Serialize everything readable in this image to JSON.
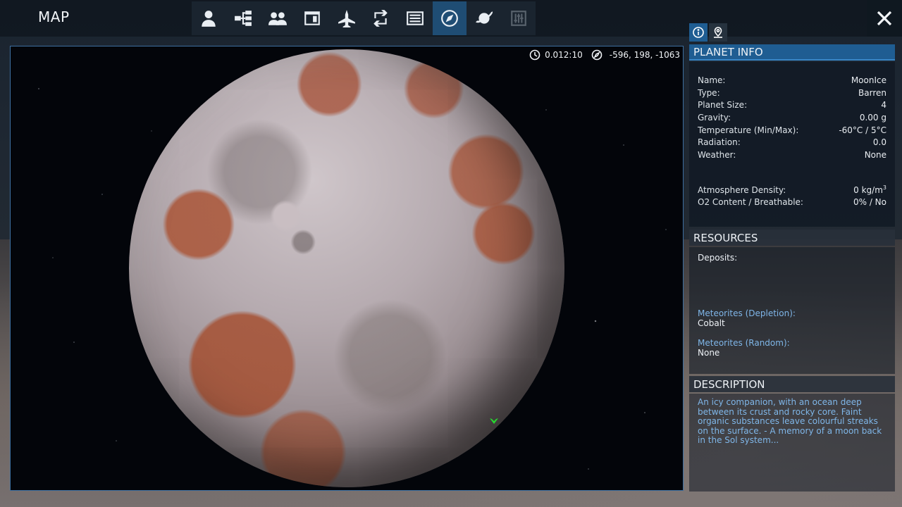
{
  "header": {
    "title": "MAP",
    "tabs": [
      {
        "name": "person-icon",
        "active": false
      },
      {
        "name": "tech-tree-icon",
        "active": false
      },
      {
        "name": "group-icon",
        "active": false
      },
      {
        "name": "window-icon",
        "active": false
      },
      {
        "name": "aircraft-icon",
        "active": false
      },
      {
        "name": "exchange-icon",
        "active": false
      },
      {
        "name": "list-icon",
        "active": false
      },
      {
        "name": "compass-icon",
        "active": true
      },
      {
        "name": "planet-icon",
        "active": false
      },
      {
        "name": "sliders-icon",
        "active": false,
        "dimmed": true
      }
    ]
  },
  "hud": {
    "time": "0.012:10",
    "coordinates": "-596, 198, -1063"
  },
  "planet_info": {
    "header": "PLANET INFO",
    "rows": [
      {
        "key": "Name:",
        "value": "MoonIce"
      },
      {
        "key": "Type:",
        "value": "Barren"
      },
      {
        "key": "Planet Size:",
        "value": "4"
      },
      {
        "key": "Gravity:",
        "value": "0.00 g"
      },
      {
        "key": "Temperature (Min/Max):",
        "value": "-60°C / 5°C"
      },
      {
        "key": "Radiation:",
        "value": "0.0"
      },
      {
        "key": "Weather:",
        "value": "None"
      }
    ],
    "atmosphere_density_label": "Atmosphere Density:",
    "atmosphere_density_value": "0 kg/m",
    "atmosphere_density_unit_sup": "3",
    "o2_label": "O2 Content / Breathable:",
    "o2_value": "0% / No"
  },
  "resources": {
    "header": "RESOURCES",
    "deposits_label": "Deposits:",
    "meteorites_depletion_label": "Meteorites (Depletion):",
    "meteorites_depletion_value": "Cobalt",
    "meteorites_random_label": "Meteorites (Random):",
    "meteorites_random_value": "None"
  },
  "description": {
    "header": "DESCRIPTION",
    "text": "An icy companion, with an ocean deep between its crust and rocky core. Faint organic substances leave colourful streaks on the surface. - A memory of a moon back in the Sol system..."
  },
  "colors": {
    "accent": "#1f5d92",
    "label": "#7fb6e8",
    "marker": "#27d830"
  }
}
